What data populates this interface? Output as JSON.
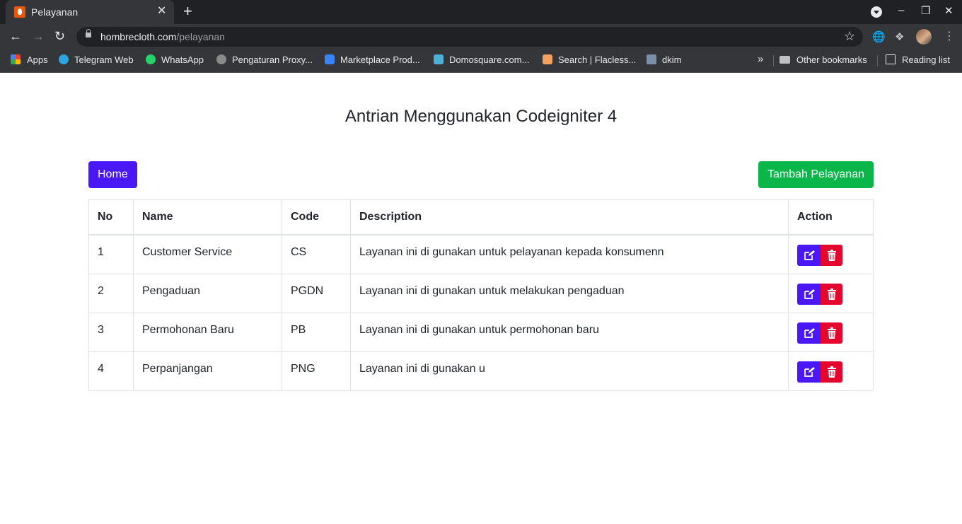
{
  "browser": {
    "tab_title": "Pelayanan",
    "tab_close": "✕",
    "new_tab": "+",
    "url_host": "hombrecloth.com",
    "url_path": "/pelayanan",
    "bookmarks": [
      "Apps",
      "Telegram Web",
      "WhatsApp",
      "Pengaturan Proxy...",
      "Marketplace Prod...",
      "Domosquare.com...",
      "Search | Flacless...",
      "dkim"
    ],
    "overflow": "»",
    "other_bookmarks": "Other bookmarks",
    "reading_list": "Reading list",
    "colors": {
      "chrome_dark": "#202124",
      "chrome": "#35363a"
    }
  },
  "page": {
    "title": "Antrian Menggunakan Codeigniter 4",
    "home_button": "Home",
    "add_button": "Tambah Pelayanan",
    "columns": [
      "No",
      "Name",
      "Code",
      "Description",
      "Action"
    ],
    "rows": [
      {
        "no": "1",
        "name": "Customer Service",
        "code": "CS",
        "description": "Layanan ini di gunakan untuk pelayanan kepada konsumenn"
      },
      {
        "no": "2",
        "name": "Pengaduan",
        "code": "PGDN",
        "description": "Layanan ini di gunakan untuk melakukan pengaduan"
      },
      {
        "no": "3",
        "name": "Permohonan Baru",
        "code": "PB",
        "description": "Layanan ini di gunakan untuk permohonan baru"
      },
      {
        "no": "4",
        "name": "Perpanjangan",
        "code": "PNG",
        "description": "Layanan ini di gunakan u"
      }
    ],
    "colors": {
      "primary": "#4a18f5",
      "success": "#0ab64a",
      "danger": "#e4062f"
    },
    "icons": {
      "edit": "edit-icon",
      "delete": "trash-icon"
    }
  }
}
